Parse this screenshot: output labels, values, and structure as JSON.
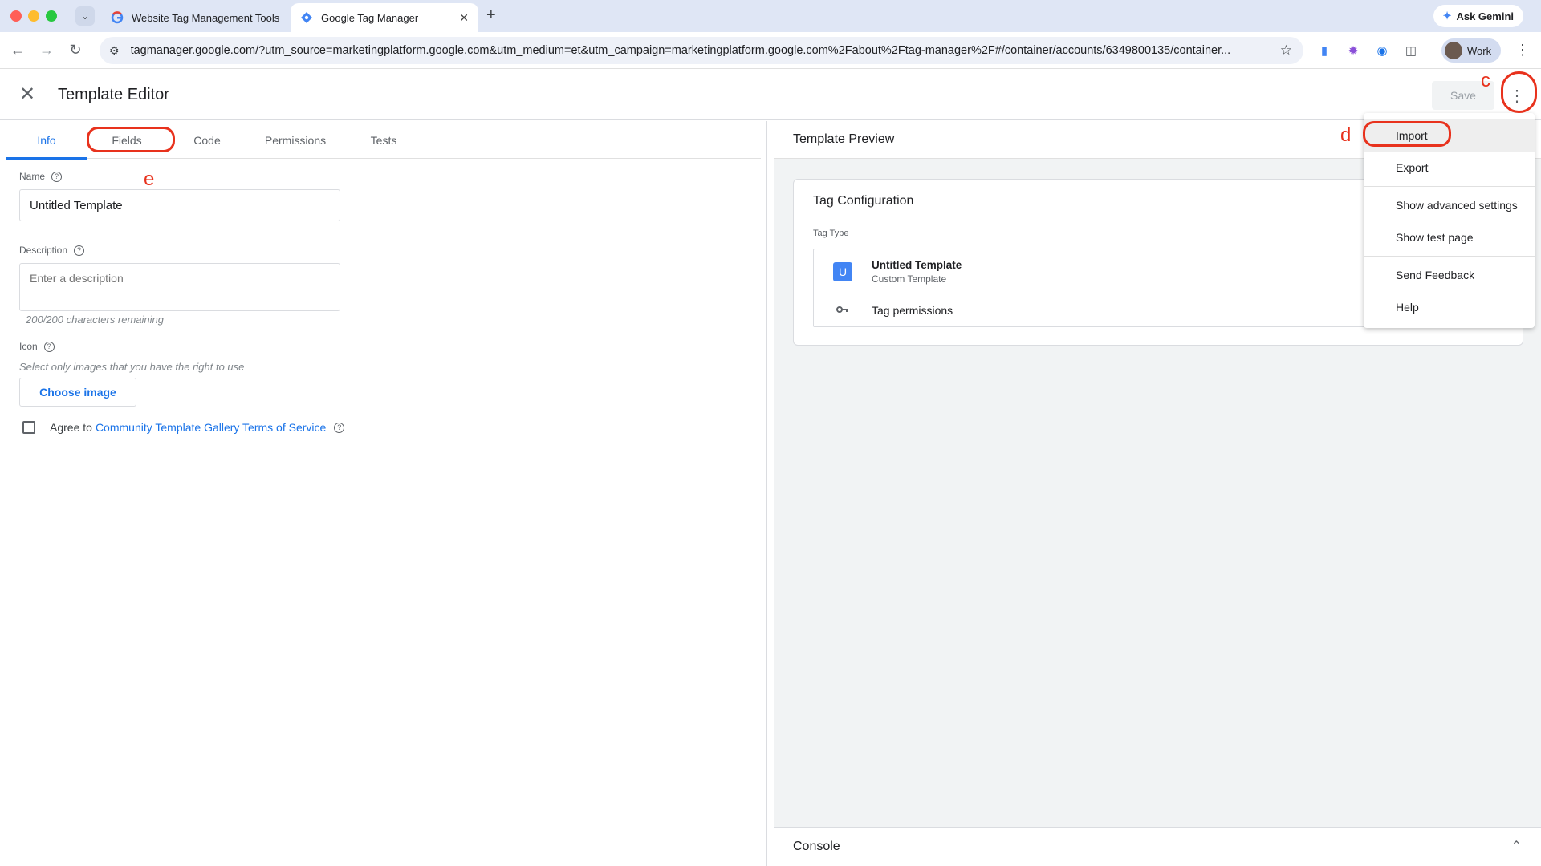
{
  "browser": {
    "tabs": [
      {
        "title": "Website Tag Management Tools",
        "active": false
      },
      {
        "title": "Google Tag Manager",
        "active": true
      }
    ],
    "url": "tagmanager.google.com/?utm_source=marketingplatform.google.com&utm_medium=et&utm_campaign=marketingplatform.google.com%2Fabout%2Ftag-manager%2F#/container/accounts/6349800135/container...",
    "gemini_label": "Ask Gemini",
    "profile_label": "Work"
  },
  "header": {
    "title": "Template Editor",
    "save_label": "Save"
  },
  "editor": {
    "tabs": [
      "Info",
      "Fields",
      "Code",
      "Permissions",
      "Tests"
    ],
    "active_tab": "Info",
    "name_label": "Name",
    "name_value": "Untitled Template",
    "description_label": "Description",
    "description_placeholder": "Enter a description",
    "chars_remaining": "200/200 characters remaining",
    "icon_label": "Icon",
    "icon_hint": "Select only images that you have the right to use",
    "choose_image": "Choose image",
    "agree_prefix": "Agree to",
    "agree_link": "Community Template Gallery Terms of Service"
  },
  "preview": {
    "title": "Template Preview",
    "card_title": "Tag Configuration",
    "tag_type_label": "Tag Type",
    "badge_letter": "U",
    "tag_name": "Untitled Template",
    "tag_sub": "Custom Template",
    "permissions_label": "Tag permissions",
    "console_label": "Console"
  },
  "menu": {
    "items": [
      "Import",
      "Export",
      "Show advanced settings",
      "Show test page",
      "Send Feedback",
      "Help"
    ]
  },
  "annotations": {
    "c": "c",
    "d": "d",
    "e": "e",
    "color": "#e8321d"
  }
}
